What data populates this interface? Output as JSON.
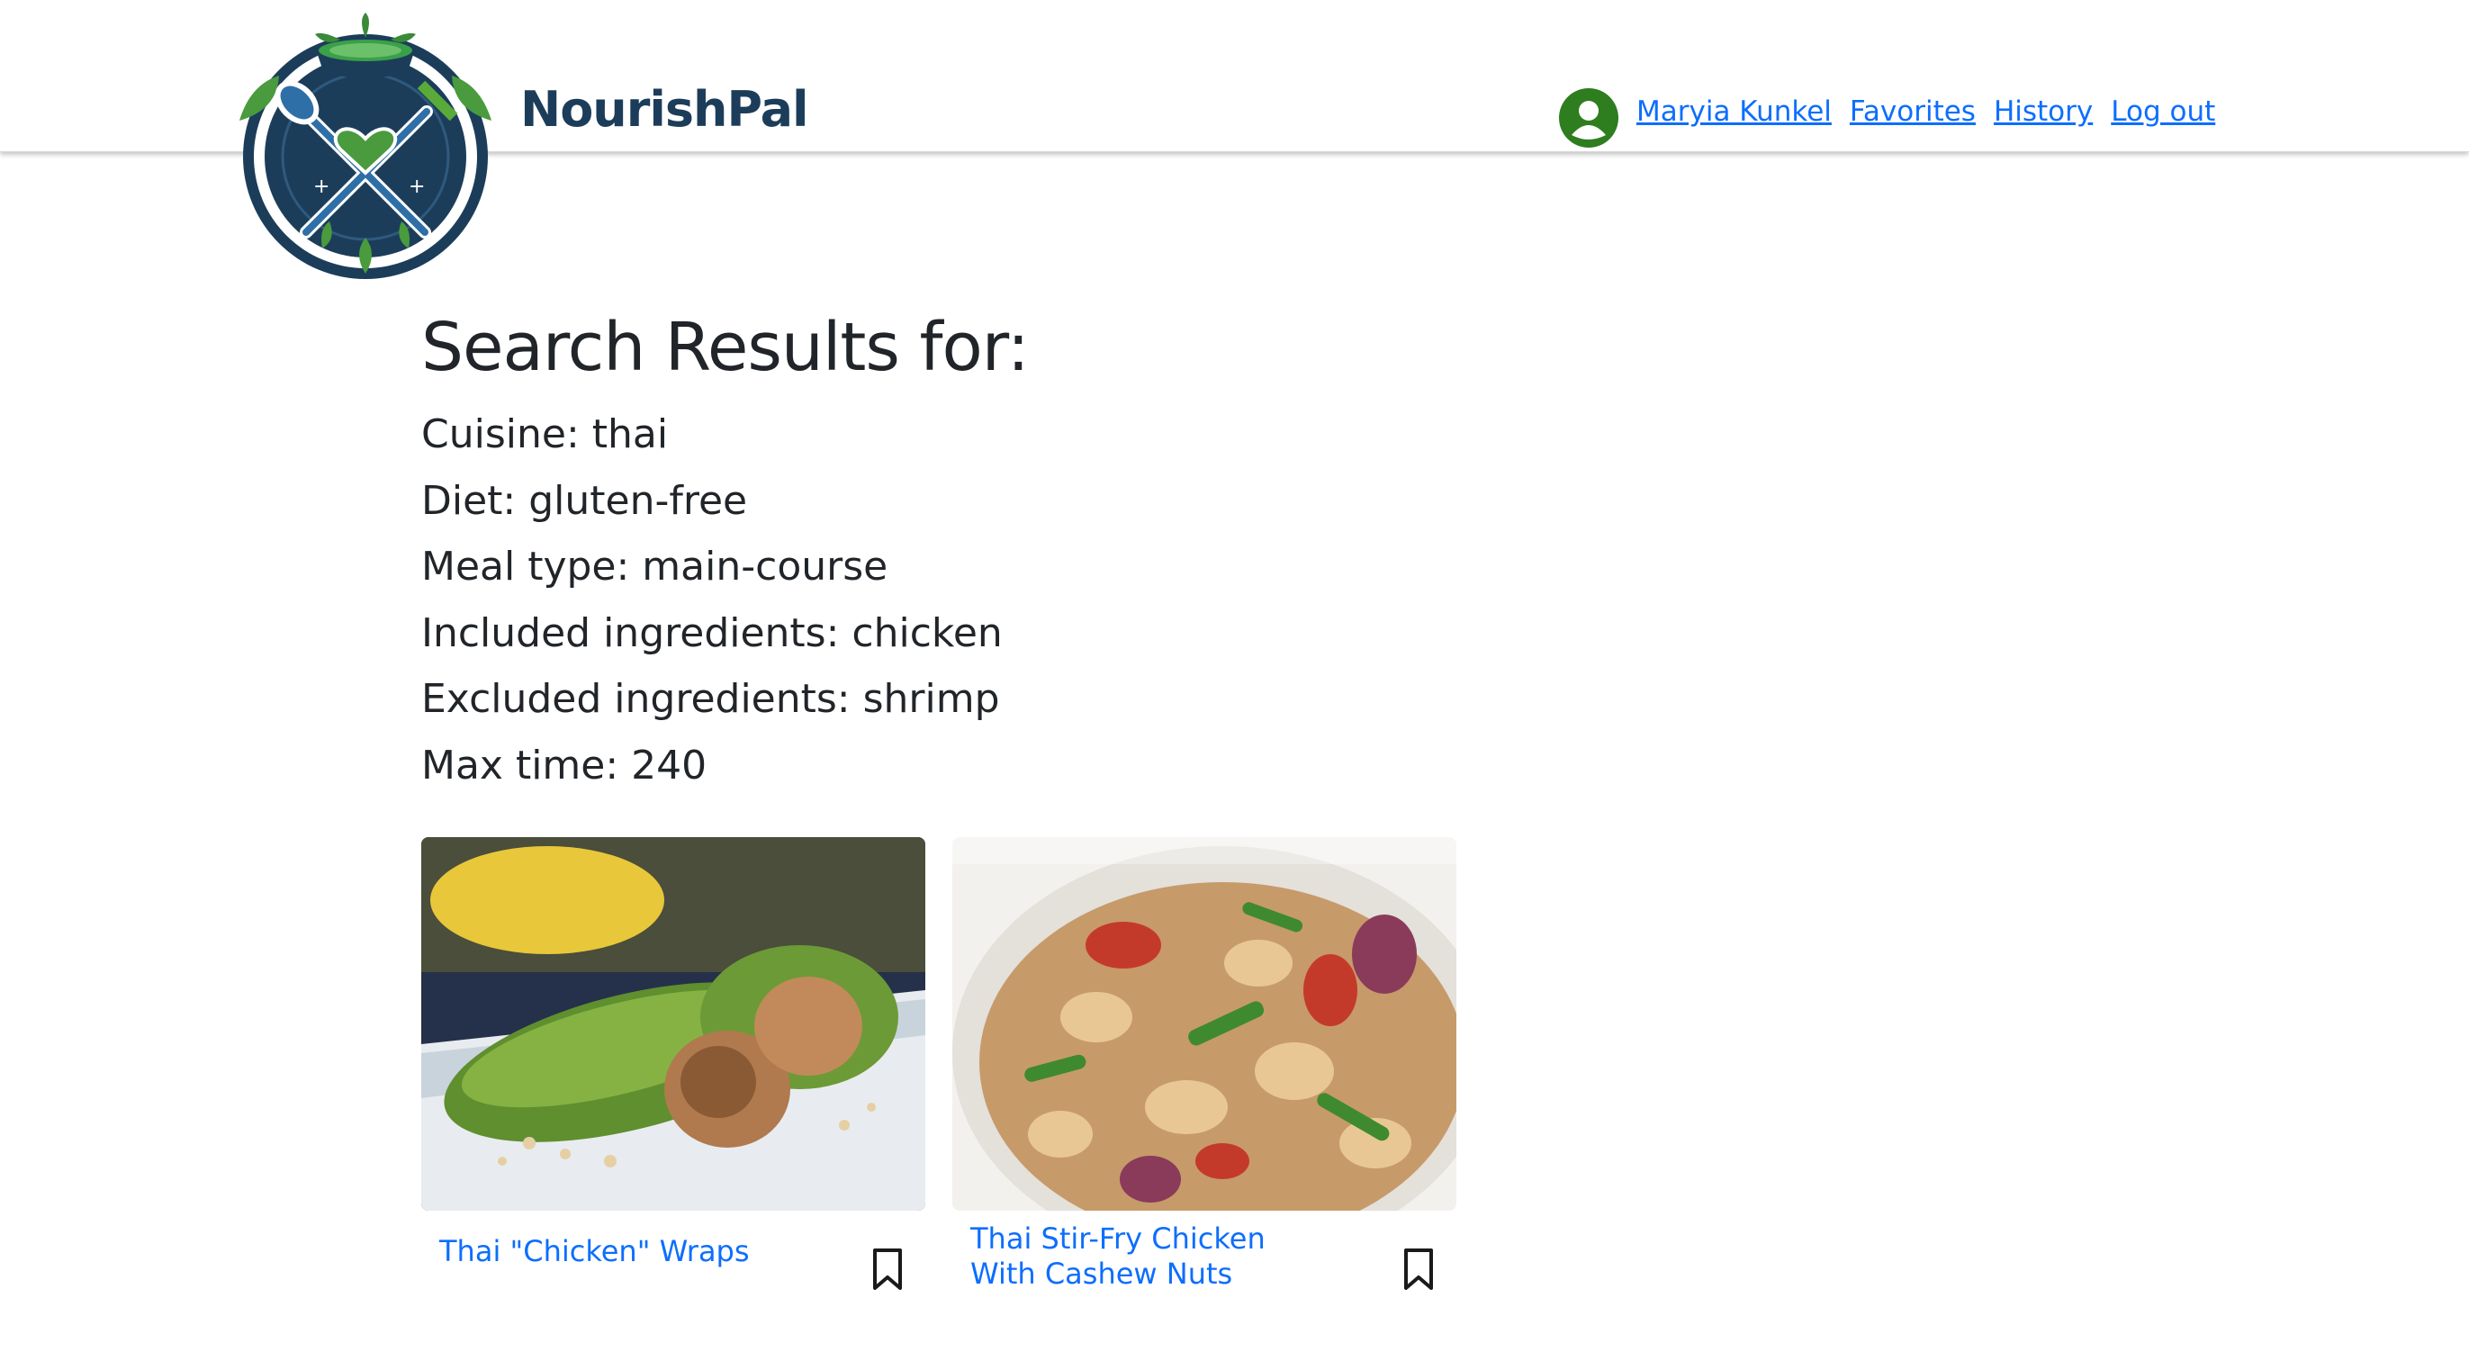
{
  "brand": {
    "name": "NourishPal",
    "primary_color": "#1c3d5a",
    "accent_color": "#3a8a3a"
  },
  "nav": {
    "user_name": "Maryia Kunkel",
    "links": [
      "Favorites",
      "History",
      "Log out"
    ],
    "link_color": "#0d6efd"
  },
  "search": {
    "title": "Search Results for:",
    "criteria": [
      "Cuisine: thai",
      "Diet: gluten-free",
      "Meal type: main-course",
      "Included ingredients: chicken",
      "Excluded ingredients: shrimp",
      "Max time: 240"
    ]
  },
  "results": [
    {
      "title": "Thai \"Chicken\" Wraps",
      "icon": "bookmark-icon"
    },
    {
      "title": "Thai Stir-Fry Chicken With Cashew Nuts",
      "icon": "bookmark-icon"
    }
  ]
}
